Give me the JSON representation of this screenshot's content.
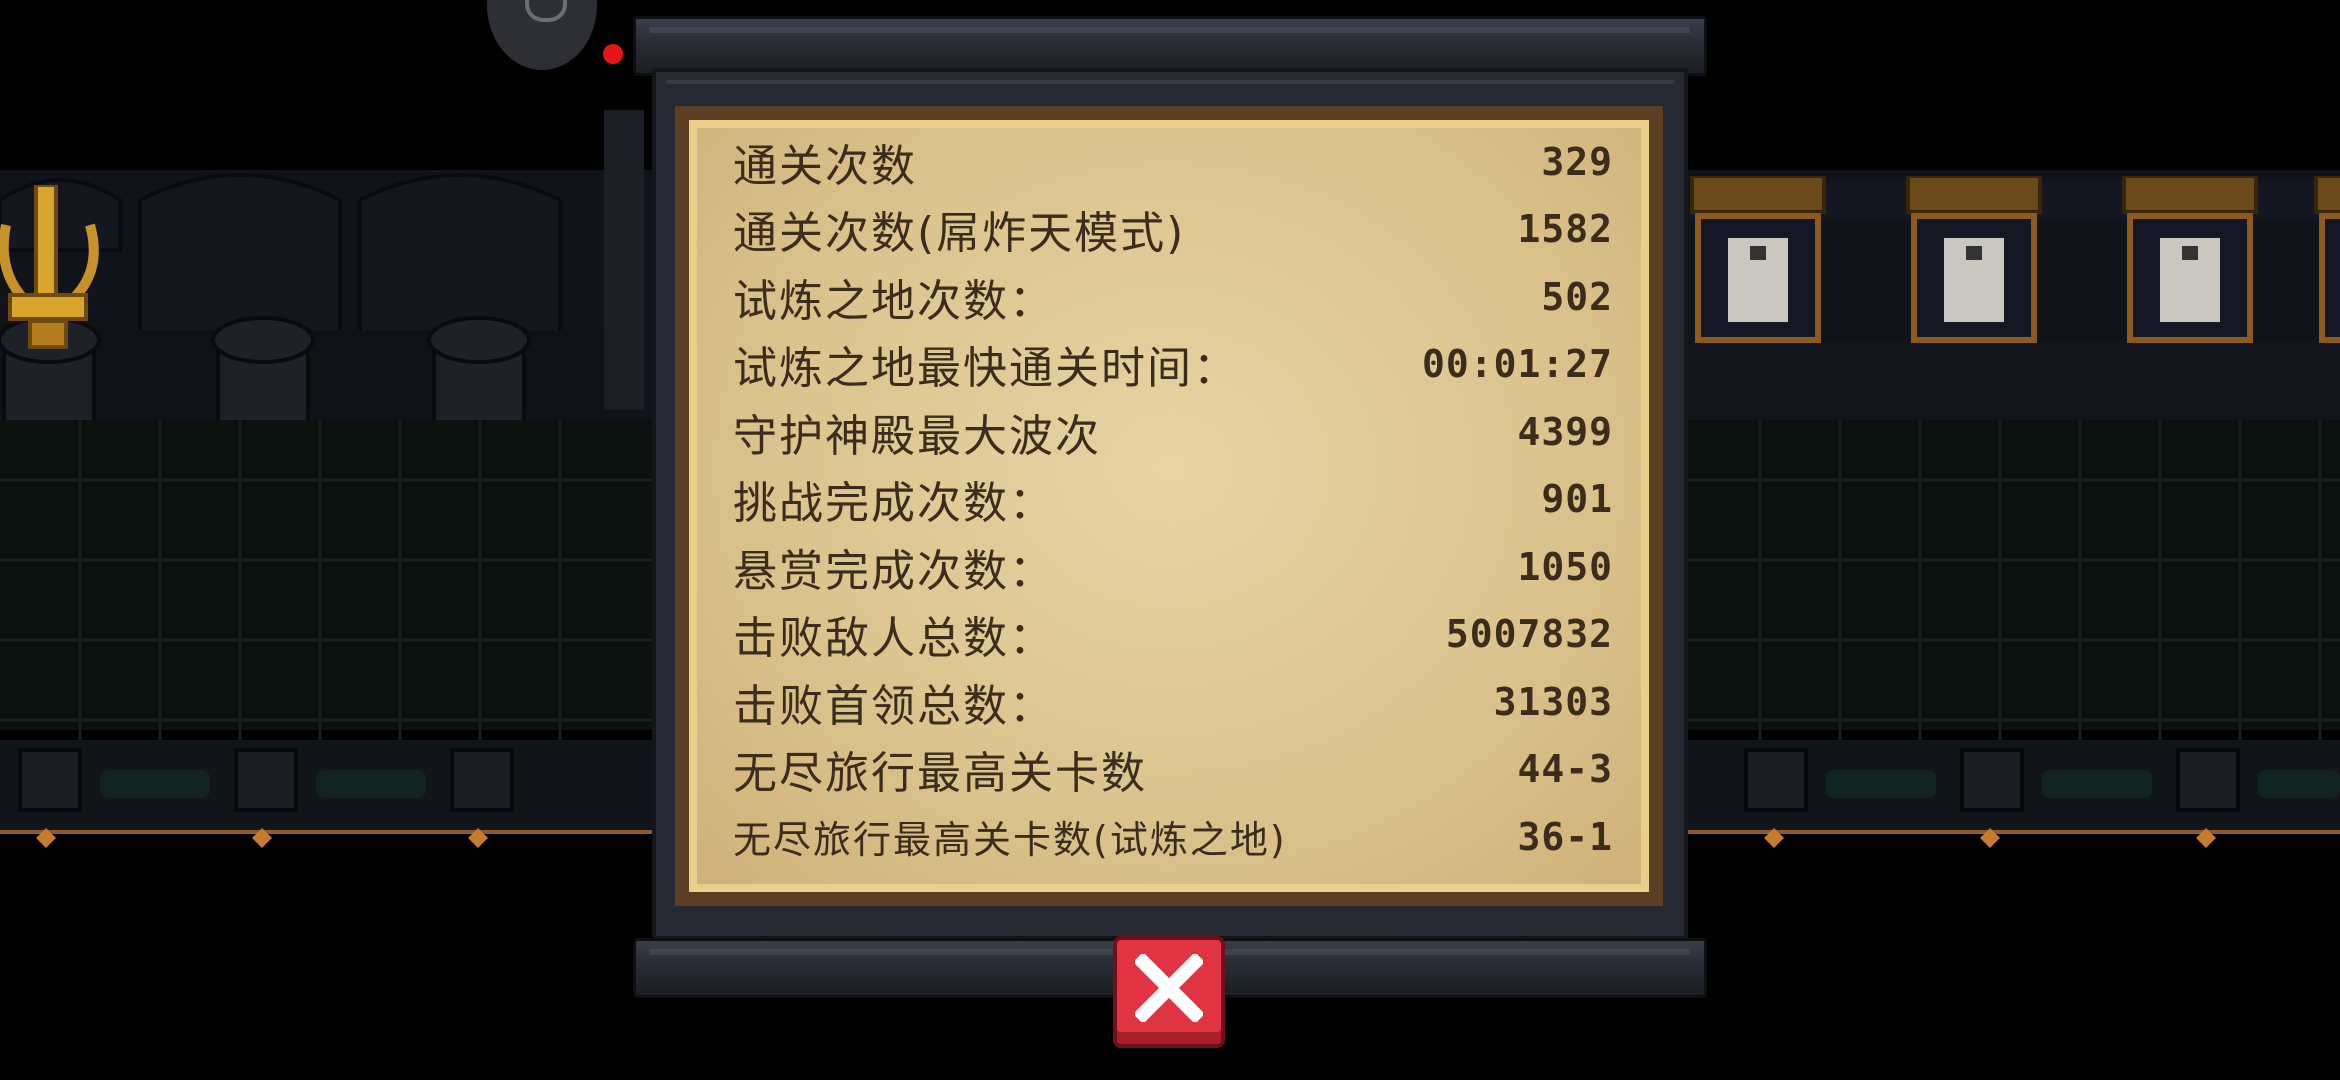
{
  "stats_panel": {
    "rows": [
      {
        "label": "通关次数",
        "value": "329"
      },
      {
        "label": "通关次数(屌炸天模式)",
        "value": "1582"
      },
      {
        "label": "试炼之地次数：",
        "value": "502"
      },
      {
        "label": "试炼之地最快通关时间：",
        "value": "00:01:27"
      },
      {
        "label": "守护神殿最大波次",
        "value": "4399"
      },
      {
        "label": "挑战完成次数：",
        "value": "901"
      },
      {
        "label": "悬赏完成次数：",
        "value": "1050"
      },
      {
        "label": "击败敌人总数：",
        "value": "5007832"
      },
      {
        "label": "击败首领总数：",
        "value": "31303"
      },
      {
        "label": "无尽旅行最高关卡数",
        "value": "44-3"
      },
      {
        "label": "无尽旅行最高关卡数(试炼之地)",
        "value": "36-1"
      }
    ]
  },
  "icons": {
    "close": "close-icon",
    "top_button": "helmet-icon",
    "trophy": "sword-trophy-icon"
  },
  "colors": {
    "paper": "#e6d4a3",
    "text": "#3b2c1c",
    "close_button": "#e03443",
    "notification": "#e8121a"
  }
}
